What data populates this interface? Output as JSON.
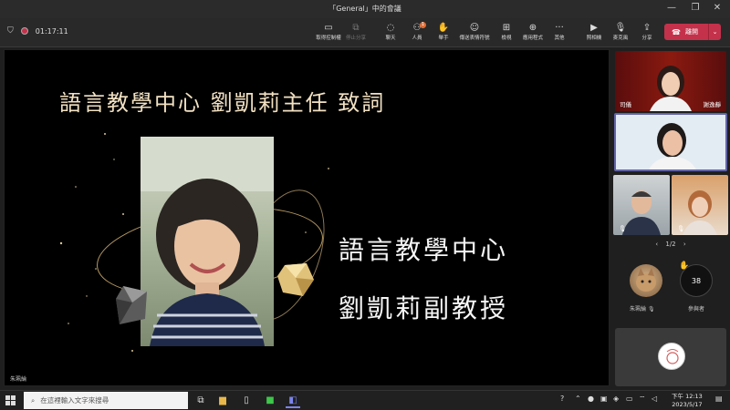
{
  "window": {
    "title": "「General」中的會議"
  },
  "toolbar": {
    "timer": "01:17:11",
    "buttons": [
      {
        "label": "取得控制權",
        "icon": "request-control-icon"
      },
      {
        "label": "停止分享",
        "icon": "stop-sharing-icon"
      },
      {
        "label": "聊天",
        "icon": "chat-icon"
      },
      {
        "label": "人員",
        "icon": "people-icon",
        "badge": "1"
      },
      {
        "label": "舉手",
        "icon": "raise-hand-icon"
      },
      {
        "label": "傳送表情符號",
        "icon": "reactions-icon"
      },
      {
        "label": "檢視",
        "icon": "view-icon"
      },
      {
        "label": "應用程式",
        "icon": "apps-icon"
      },
      {
        "label": "其他",
        "icon": "more-icon"
      },
      {
        "label": "照相機",
        "icon": "camera-icon"
      },
      {
        "label": "麥克風",
        "icon": "microphone-icon"
      },
      {
        "label": "分享",
        "icon": "share-icon"
      }
    ],
    "leave_label": "離開"
  },
  "slide": {
    "title": "語言教學中心 劉凱莉主任 致詞",
    "line1": "語言教學中心",
    "line2": "劉凱莉副教授",
    "presenter_name": "朱珮綸"
  },
  "participants": {
    "tile1_name_left": "司儀",
    "tile1_name_right": "謝逸靜",
    "pager": "1/2",
    "avatar_person_name": "朱珮綸",
    "attendee_count": "38",
    "attendee_label": "參與者"
  },
  "taskbar": {
    "search_placeholder": "在這裡輸入文字來搜尋",
    "time": "下午 12:13",
    "date": "2023/5/17"
  },
  "colors": {
    "accent": "#c4314b",
    "gold": "#f2e1c2"
  }
}
